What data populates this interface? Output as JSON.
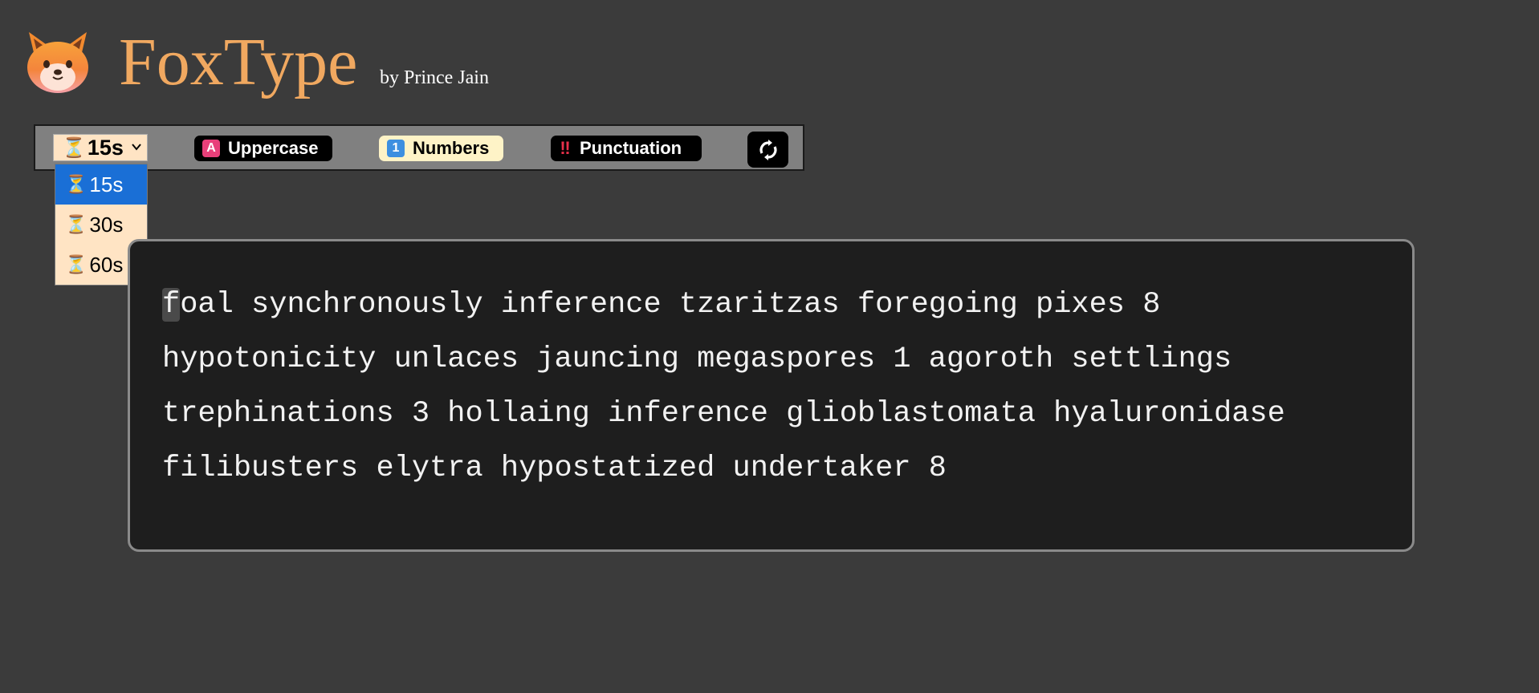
{
  "app": {
    "title": "FoxType",
    "author": "by Prince Jain",
    "logo_icon": "fox-face-icon"
  },
  "toolbar": {
    "time_select": {
      "icon": "hourglass-icon",
      "value": "15s",
      "options": [
        "15s",
        "30s",
        "60s"
      ],
      "selected_index": 0
    },
    "toggles": [
      {
        "label": "Uppercase",
        "icon": "letter-a-icon",
        "glyph": "A",
        "active": false
      },
      {
        "label": "Numbers",
        "icon": "keycap-1-icon",
        "glyph": "1",
        "active": true
      },
      {
        "label": "Punctuation",
        "icon": "double-exclamation-icon",
        "glyph": "‼",
        "active": false
      }
    ],
    "reset_icon": "reset-arrows-icon"
  },
  "test": {
    "first_char": "f",
    "lines": [
      "oal synchronously inference tzaritzas foregoing pixes 8",
      "hypotonicity unlaces jauncing megaspores 1 agoroth settlings",
      "trephinations 3 hollaing inference glioblastomata hyaluronidase",
      "filibusters elytra hypostatized undertaker 8"
    ]
  },
  "colors": {
    "background": "#3b3b3b",
    "title": "#f0a860",
    "dropdown_bg": "#ffe4c4",
    "selected_option": "#1a6fd6",
    "typing_bg": "#1e1e1e"
  }
}
